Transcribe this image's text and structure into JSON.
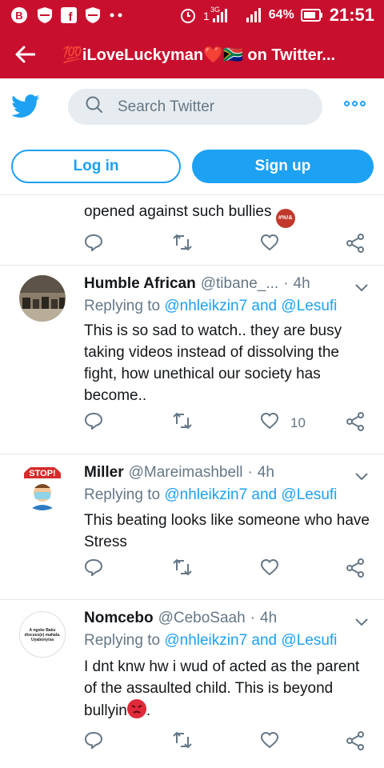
{
  "status_bar": {
    "network": "3G",
    "battery": "64%",
    "time": "21:51"
  },
  "app_bar": {
    "title": "💯iLoveLuckyman❤️🇿🇦 on Twitter..."
  },
  "header": {
    "search_placeholder": "Search Twitter",
    "login_label": "Log in",
    "signup_label": "Sign up"
  },
  "tweets": [
    {
      "partial_text": "opened against such bullies",
      "emoji_text": "#%!&"
    },
    {
      "name": "Humble African",
      "handle": "@tibane_...",
      "time": "4h",
      "replying_prefix": "Replying to",
      "mention1": "@nhleikzin7",
      "and": "and",
      "mention2": "@Lesufi",
      "text": "This is so sad to watch.. they are busy taking videos instead of dissolving the fight, how unethical our society has become..",
      "likes": "10"
    },
    {
      "name": "Miller",
      "handle": "@Mareimashbell",
      "time": "4h",
      "replying_prefix": "Replying to",
      "mention1": "@nhleikzin7",
      "and": "and",
      "mention2": "@Lesufi",
      "text": "This beating looks like someone who have Stress",
      "avatar_sign": "STOP!"
    },
    {
      "name": "Nomcebo",
      "handle": "@CeboSaah",
      "time": "4h",
      "replying_prefix": "Replying to",
      "mention1": "@nhleikzin7",
      "and": "and",
      "mention2": "@Lesufi",
      "text": "I dnt knw hw i wud of acted as the parent of the assaulted child. This is beyond bullyin",
      "text_end": ".",
      "avatar_text": "A ngeke Baku discuss(e) mahala. Uyabonyisa"
    }
  ],
  "colors": {
    "status_red": "#c8102e",
    "twitter_blue": "#1da1f2",
    "muted_gray": "#657786"
  }
}
